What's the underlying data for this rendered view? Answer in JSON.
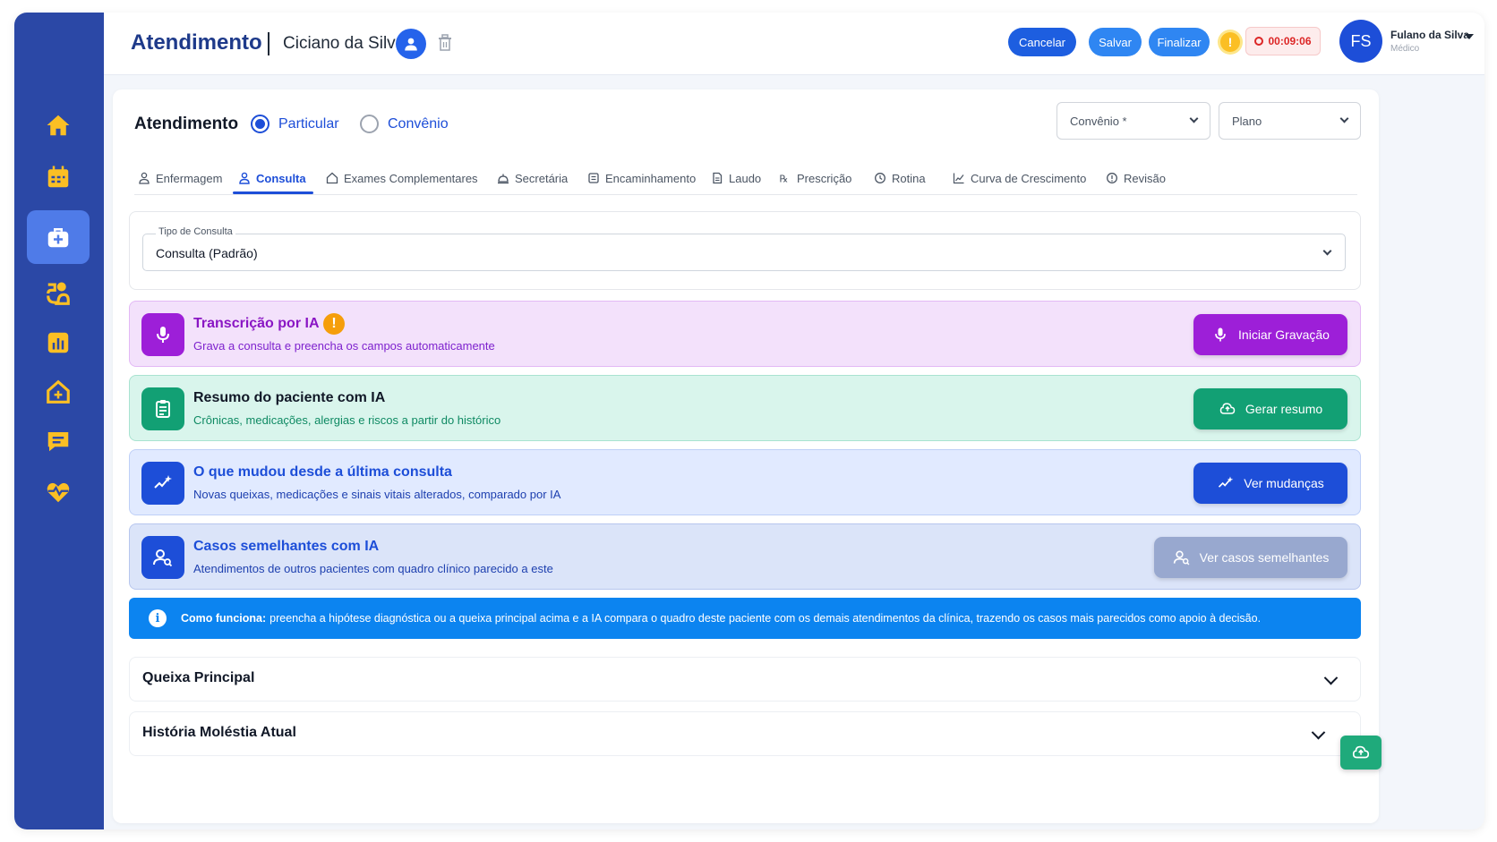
{
  "header": {
    "app_title": "Atendimento",
    "patient_name": "Ciciano da Silva",
    "buttons": {
      "cancel": "Cancelar",
      "save": "Salvar",
      "finish": "Finalizar"
    },
    "warning_glyph": "!",
    "timer": "00:09:06",
    "user": {
      "initials": "FS",
      "name": "Fulano da Silva",
      "role": "Médico"
    }
  },
  "sidebar": {
    "items": [
      {
        "icon": "home-icon"
      },
      {
        "icon": "calendar-icon"
      },
      {
        "icon": "medical-kit-icon",
        "active": true
      },
      {
        "icon": "reception-icon"
      },
      {
        "icon": "bar-chart-icon"
      },
      {
        "icon": "clinic-icon"
      },
      {
        "icon": "message-icon"
      },
      {
        "icon": "heart-pulse-icon"
      }
    ],
    "accent_color": "#fbbf24"
  },
  "attendance": {
    "title": "Atendimento",
    "radio_options": [
      {
        "label": "Particular",
        "checked": true
      },
      {
        "label": "Convênio",
        "checked": false
      }
    ],
    "convenio_select": "Convênio *",
    "plano_select": "Plano"
  },
  "tabs": [
    {
      "label": "Enfermagem"
    },
    {
      "label": "Consulta",
      "active": true
    },
    {
      "label": "Exames Complementares"
    },
    {
      "label": "Secretária"
    },
    {
      "label": "Encaminhamento"
    },
    {
      "label": "Laudo"
    },
    {
      "label": "Prescrição"
    },
    {
      "label": "Rotina"
    },
    {
      "label": "Curva de Crescimento"
    },
    {
      "label": "Revisão"
    }
  ],
  "consult_type": {
    "legend": "Tipo de Consulta",
    "value": "Consulta (Padrão)"
  },
  "ai_cards": [
    {
      "title": "Transcrição por IA",
      "subtitle": "Grava a consulta e preencha os campos automaticamente",
      "button": "Iniciar Gravação",
      "color": "#9d1fd8"
    },
    {
      "title": "Resumo do paciente com IA",
      "subtitle": "Crônicas, medicações, alergias e riscos a partir do histórico",
      "button": "Gerar resumo",
      "color": "#12a074"
    },
    {
      "title": "O que mudou desde a última consulta",
      "subtitle": "Novas queixas, medicações e sinais vitais alterados, comparado por IA",
      "button": "Ver mudanças",
      "color": "#1d4ed8"
    },
    {
      "title": "Casos semelhantes com IA",
      "subtitle": "Atendimentos de outros pacientes com quadro clínico parecido a este",
      "button": "Ver casos semelhantes",
      "color": "#1d4ed8"
    }
  ],
  "info_bar": {
    "label": "Como funciona:",
    "text": "preencha a hipótese diagnóstica ou a queixa principal acima e a IA compara o quadro deste paciente com os demais atendimentos da clínica, trazendo os casos mais parecidos como apoio à decisão.",
    "icon_glyph": "i"
  },
  "sections": [
    {
      "title": "Queixa Principal"
    },
    {
      "title": "História Moléstia Atual"
    }
  ]
}
